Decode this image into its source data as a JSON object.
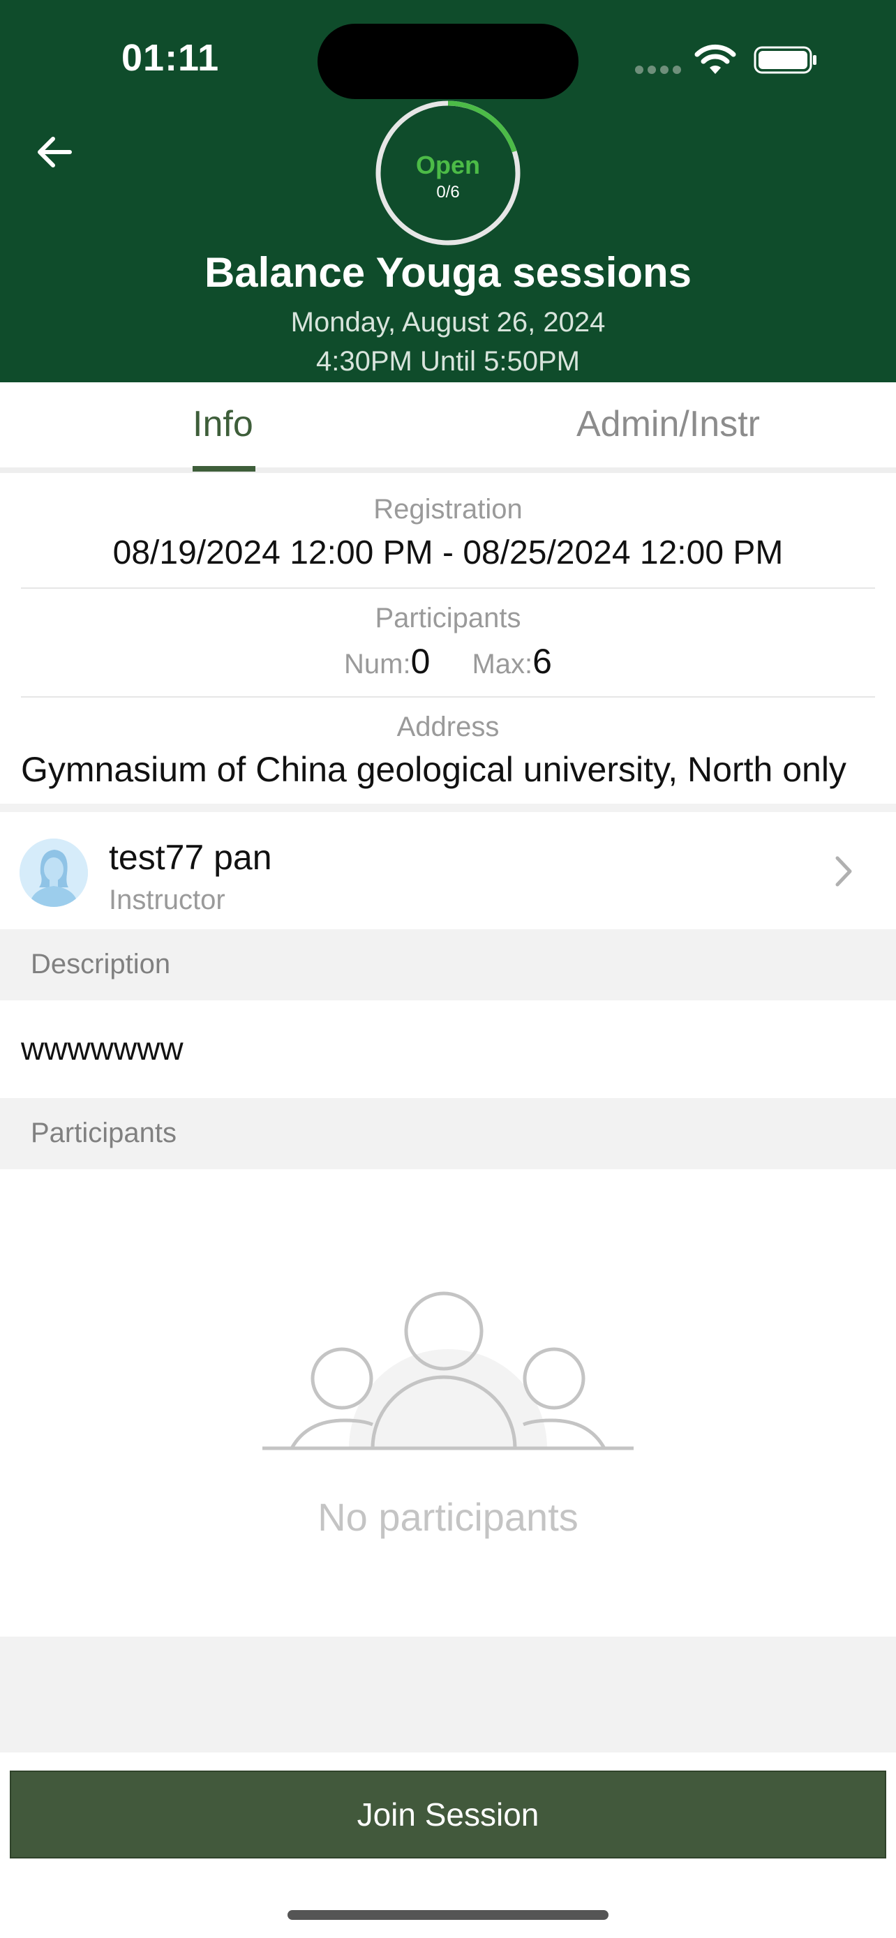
{
  "status_bar": {
    "time": "01:11",
    "wifi_icon": "wifi-icon",
    "battery_icon": "battery-icon"
  },
  "header": {
    "back_icon": "arrow-left-icon",
    "ring": {
      "status": "Open",
      "count": "0/6",
      "fill_fraction": 0.2,
      "accent": "#4cbb47"
    },
    "title": "Balance Youga sessions",
    "date": "Monday, August 26, 2024",
    "time_range": "4:30PM Until 5:50PM",
    "bg_color": "#0f4c2b"
  },
  "tabs": [
    {
      "label": "Info",
      "active": true
    },
    {
      "label": "Admin/Instr",
      "active": false
    }
  ],
  "info": {
    "registration_label": "Registration",
    "registration_value": "08/19/2024 12:00 PM - 08/25/2024 12:00 PM",
    "participants_label": "Participants",
    "num_label": "Num:",
    "num_value": "0",
    "max_label": "Max:",
    "max_value": "6",
    "address_label": "Address",
    "address_value": "Gymnasium of China geological university, North only"
  },
  "instructor": {
    "name": "test77 pan",
    "role": "Instructor",
    "chevron_icon": "chevron-right-icon"
  },
  "description": {
    "header": "Description",
    "text": "wwwwwww"
  },
  "participants_section": {
    "header": "Participants",
    "empty_icon": "people-group-icon",
    "empty_text": "No participants"
  },
  "actions": {
    "join_label": "Join Session",
    "join_color": "#42593c"
  }
}
